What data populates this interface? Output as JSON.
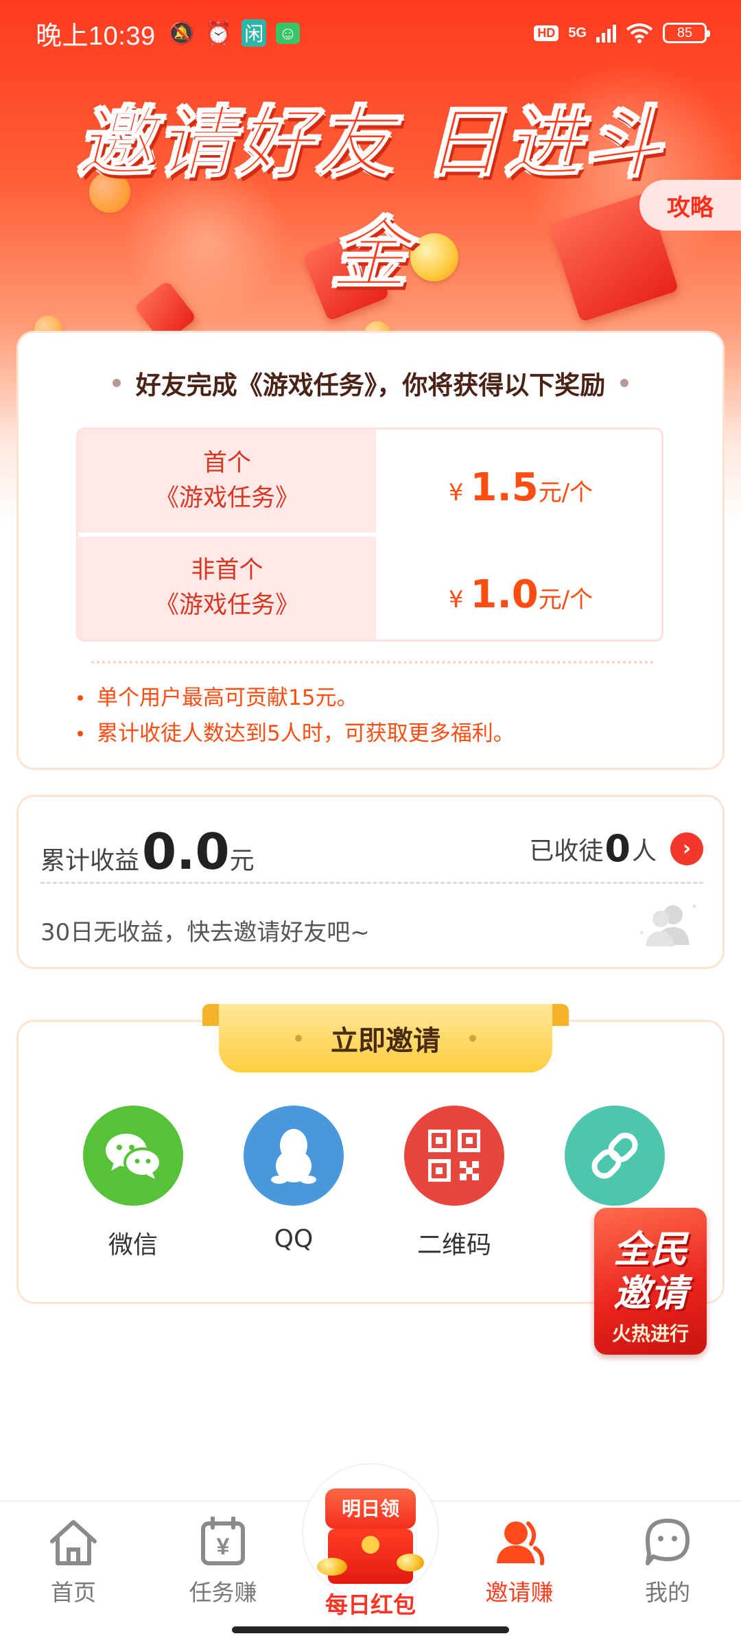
{
  "status_bar": {
    "time": "晚上10:39",
    "hd_label": "HD",
    "network": "5G",
    "battery": "85"
  },
  "hero": {
    "title": "邀请好友 日进斗金",
    "strategy_label": "攻略"
  },
  "rewards": {
    "heading": "好友完成《游戏任务》，你将获得以下奖励",
    "rows": [
      {
        "label_line1": "首个",
        "label_line2": "《游戏任务》",
        "currency": "¥",
        "amount": "1.5",
        "unit": "元/个"
      },
      {
        "label_line1": "非首个",
        "label_line2": "《游戏任务》",
        "currency": "¥",
        "amount": "1.0",
        "unit": "元/个"
      }
    ],
    "notes": [
      "单个用户最高可贡献15元。",
      "累计收徒人数达到5人时，可获取更多福利。"
    ]
  },
  "earnings": {
    "total_label": "累计收益",
    "total_value": "0.0",
    "total_unit": "元",
    "recruited_label": "已收徒",
    "recruited_value": "0",
    "recruited_unit": "人",
    "note": "30日无收益，快去邀请好友吧~"
  },
  "invite": {
    "ribbon_label": "立即邀请",
    "options": [
      {
        "label": "微信",
        "icon": "wechat-icon",
        "color": "#56c238"
      },
      {
        "label": "QQ",
        "icon": "qq-penguin-icon",
        "color": "#4a98dc"
      },
      {
        "label": "二维码",
        "icon": "qr-code-icon",
        "color": "#e8453c"
      },
      {
        "label": "链",
        "icon": "link-icon",
        "color": "#4dc6ae"
      }
    ]
  },
  "float_badge": {
    "line1": "全民",
    "line2": "邀请",
    "line3": "火热进行"
  },
  "bottom_nav": {
    "items": [
      {
        "label": "首页",
        "icon": "home-icon"
      },
      {
        "label": "任务赚",
        "icon": "task-calendar-icon"
      },
      {
        "label": "每日红包",
        "icon": "red-envelope-icon",
        "badge": "明日领"
      },
      {
        "label": "邀请赚",
        "icon": "invite-user-icon",
        "active": true
      },
      {
        "label": "我的",
        "icon": "profile-face-icon"
      }
    ]
  },
  "colors": {
    "accent": "#ff3c1c",
    "price": "#ff4d12",
    "card_border": "#ffe3d2"
  }
}
